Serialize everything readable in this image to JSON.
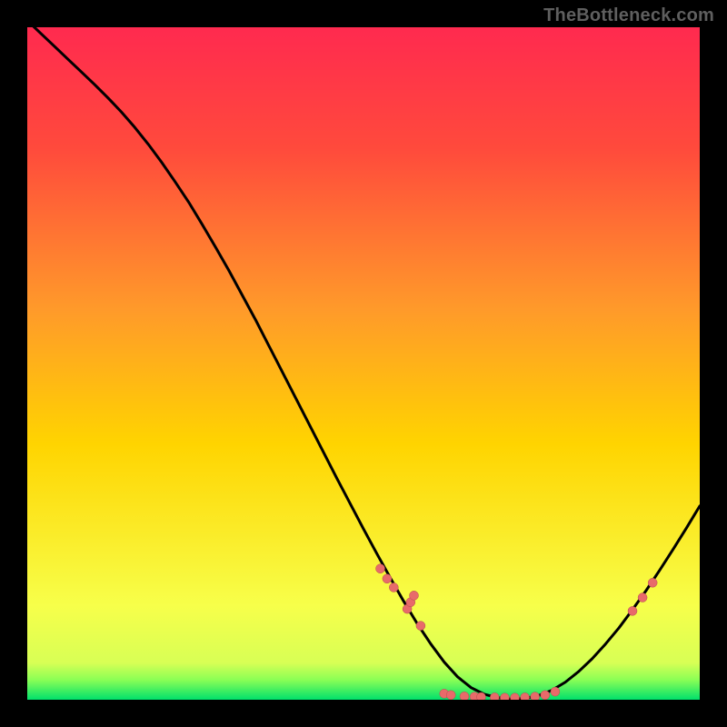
{
  "watermark": "TheBottleneck.com",
  "colors": {
    "gradient_top": "#ff2a4f",
    "gradient_mid": "#ffd400",
    "gradient_low": "#f7ff4a",
    "gradient_bottom": "#00e06b",
    "curve": "#000000",
    "marker_fill": "#e86a6a",
    "marker_stroke": "#b54d4d"
  },
  "chart_data": {
    "type": "line",
    "title": "",
    "xlabel": "",
    "ylabel": "",
    "xlim": [
      0,
      100
    ],
    "ylim": [
      0,
      100
    ],
    "x": [
      0,
      2,
      4,
      6,
      8,
      10,
      12,
      14,
      16,
      18,
      20,
      22,
      24,
      26,
      28,
      30,
      32,
      34,
      36,
      38,
      40,
      42,
      44,
      46,
      48,
      50,
      52,
      54,
      56,
      58,
      60,
      62,
      64,
      66,
      68,
      70,
      72,
      74,
      76,
      78,
      80,
      82,
      84,
      86,
      88,
      90,
      92,
      94,
      96,
      98,
      100
    ],
    "y": [
      101,
      99.1,
      97.2,
      95.3,
      93.4,
      91.5,
      89.5,
      87.4,
      85.1,
      82.6,
      79.9,
      77.0,
      74.0,
      70.7,
      67.3,
      63.8,
      60.1,
      56.4,
      52.5,
      48.6,
      44.7,
      40.8,
      36.9,
      33.0,
      29.2,
      25.4,
      21.7,
      18.1,
      14.6,
      11.3,
      8.3,
      5.6,
      3.4,
      1.8,
      0.8,
      0.3,
      0.1,
      0.2,
      0.6,
      1.4,
      2.6,
      4.2,
      6.1,
      8.3,
      10.7,
      13.4,
      16.2,
      19.2,
      22.3,
      25.5,
      28.8
    ],
    "markers": [
      {
        "x": 52.5,
        "y": 19.5
      },
      {
        "x": 53.5,
        "y": 18.0
      },
      {
        "x": 54.5,
        "y": 16.7
      },
      {
        "x": 56.5,
        "y": 13.5
      },
      {
        "x": 57.0,
        "y": 14.5
      },
      {
        "x": 57.5,
        "y": 15.5
      },
      {
        "x": 58.5,
        "y": 11.0
      },
      {
        "x": 62.0,
        "y": 0.9
      },
      {
        "x": 63.0,
        "y": 0.7
      },
      {
        "x": 65.0,
        "y": 0.5
      },
      {
        "x": 66.5,
        "y": 0.45
      },
      {
        "x": 67.5,
        "y": 0.4
      },
      {
        "x": 69.5,
        "y": 0.35
      },
      {
        "x": 71.0,
        "y": 0.3
      },
      {
        "x": 72.5,
        "y": 0.3
      },
      {
        "x": 74.0,
        "y": 0.35
      },
      {
        "x": 75.5,
        "y": 0.45
      },
      {
        "x": 77.0,
        "y": 0.7
      },
      {
        "x": 78.5,
        "y": 1.2
      },
      {
        "x": 90.0,
        "y": 13.2
      },
      {
        "x": 91.5,
        "y": 15.2
      },
      {
        "x": 93.0,
        "y": 17.4
      }
    ],
    "marker_radius": 5
  }
}
